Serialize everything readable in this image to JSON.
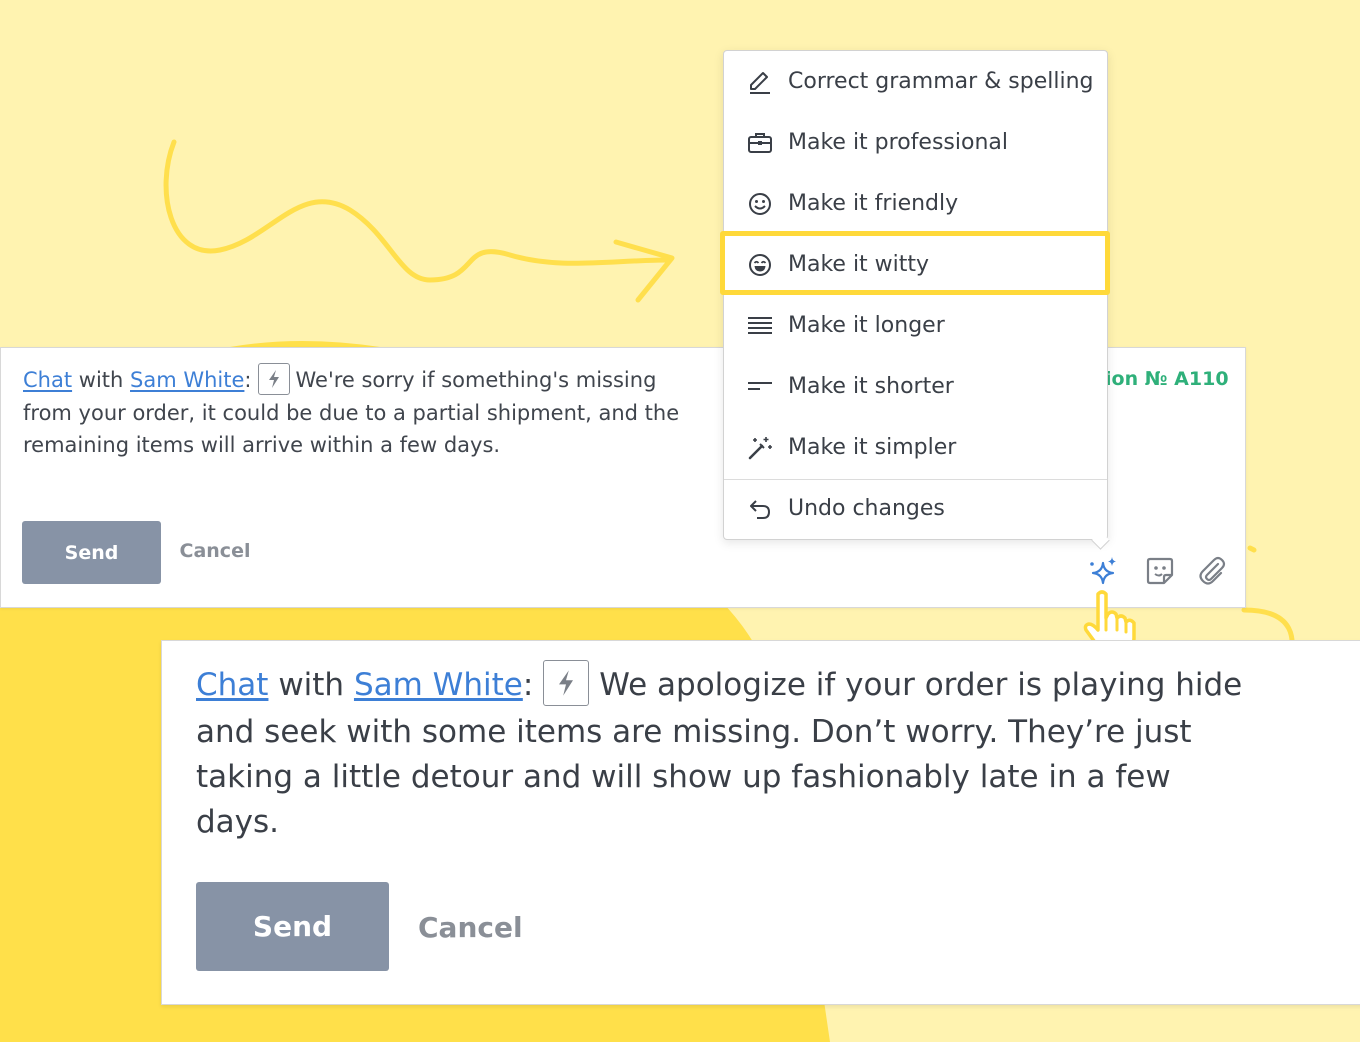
{
  "colors": {
    "background_light": "#fff3b0",
    "background_accent": "#ffe04a",
    "highlight": "#ffd93a",
    "link": "#3d7fd6",
    "send_button": "#8793a6",
    "order_ref": "#2fb07a",
    "ai_sparkle": "#3d7fd6"
  },
  "original_composer": {
    "chat_link": "Chat",
    "with_text": "with",
    "contact_link": "Sam White",
    "colon": ":",
    "bolt_icon": "lightning-icon",
    "message": "We're sorry if something's missing from your order, it could be due to a partial shipment, and the remaining items will arrive within a few days.",
    "order_ref": "ion № A110",
    "send_label": "Send",
    "cancel_label": "Cancel",
    "toolbar_icons": [
      "ai-sparkle-icon",
      "sticker-icon",
      "paperclip-icon"
    ]
  },
  "ai_menu": {
    "items": [
      {
        "label": "Correct grammar & spelling",
        "icon": "pencil-icon"
      },
      {
        "label": "Make it professional",
        "icon": "briefcase-icon"
      },
      {
        "label": "Make it friendly",
        "icon": "smile-icon"
      },
      {
        "label": "Make it witty",
        "icon": "grin-icon",
        "highlighted": true
      },
      {
        "label": "Make it longer",
        "icon": "lines-long-icon"
      },
      {
        "label": "Make it shorter",
        "icon": "lines-short-icon"
      },
      {
        "label": "Make it simpler",
        "icon": "magic-wand-icon"
      },
      {
        "label": "Undo changes",
        "icon": "undo-icon"
      }
    ]
  },
  "rewritten_composer": {
    "chat_link": "Chat",
    "with_text": "with",
    "contact_link": "Sam White",
    "colon": ":",
    "bolt_icon": "lightning-icon",
    "message": "We apologize if your order is playing hide and seek with some items are missing. Don’t worry. They’re just taking a little detour and will show up fashionably late in a few days.",
    "send_label": "Send",
    "cancel_label": "Cancel"
  }
}
